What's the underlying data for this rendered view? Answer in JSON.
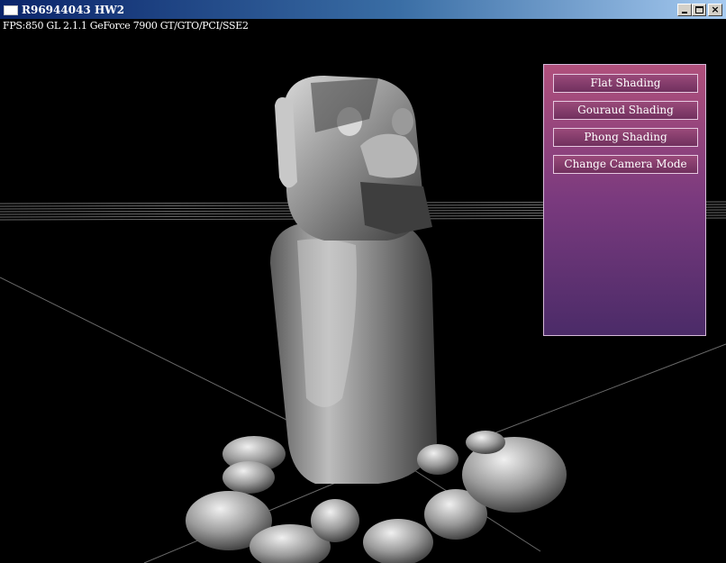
{
  "window": {
    "title": "R96944043 HW2",
    "controls": {
      "minimize": "_",
      "maximize": "□",
      "close": "×"
    }
  },
  "viewport": {
    "fps_overlay": "FPS:850 GL 2.1.1 GeForce 7900 GT/GTO/PCI/SSE2",
    "background_color": "#000000",
    "scene": "moai-statue-with-rocks"
  },
  "shading_panel": {
    "buttons": [
      {
        "label": "Flat Shading"
      },
      {
        "label": "Gouraud Shading"
      },
      {
        "label": "Phong Shading"
      },
      {
        "label": "Change Camera Mode"
      }
    ],
    "colors": {
      "top": "#b0507c",
      "bottom": "#4b2b68"
    }
  }
}
